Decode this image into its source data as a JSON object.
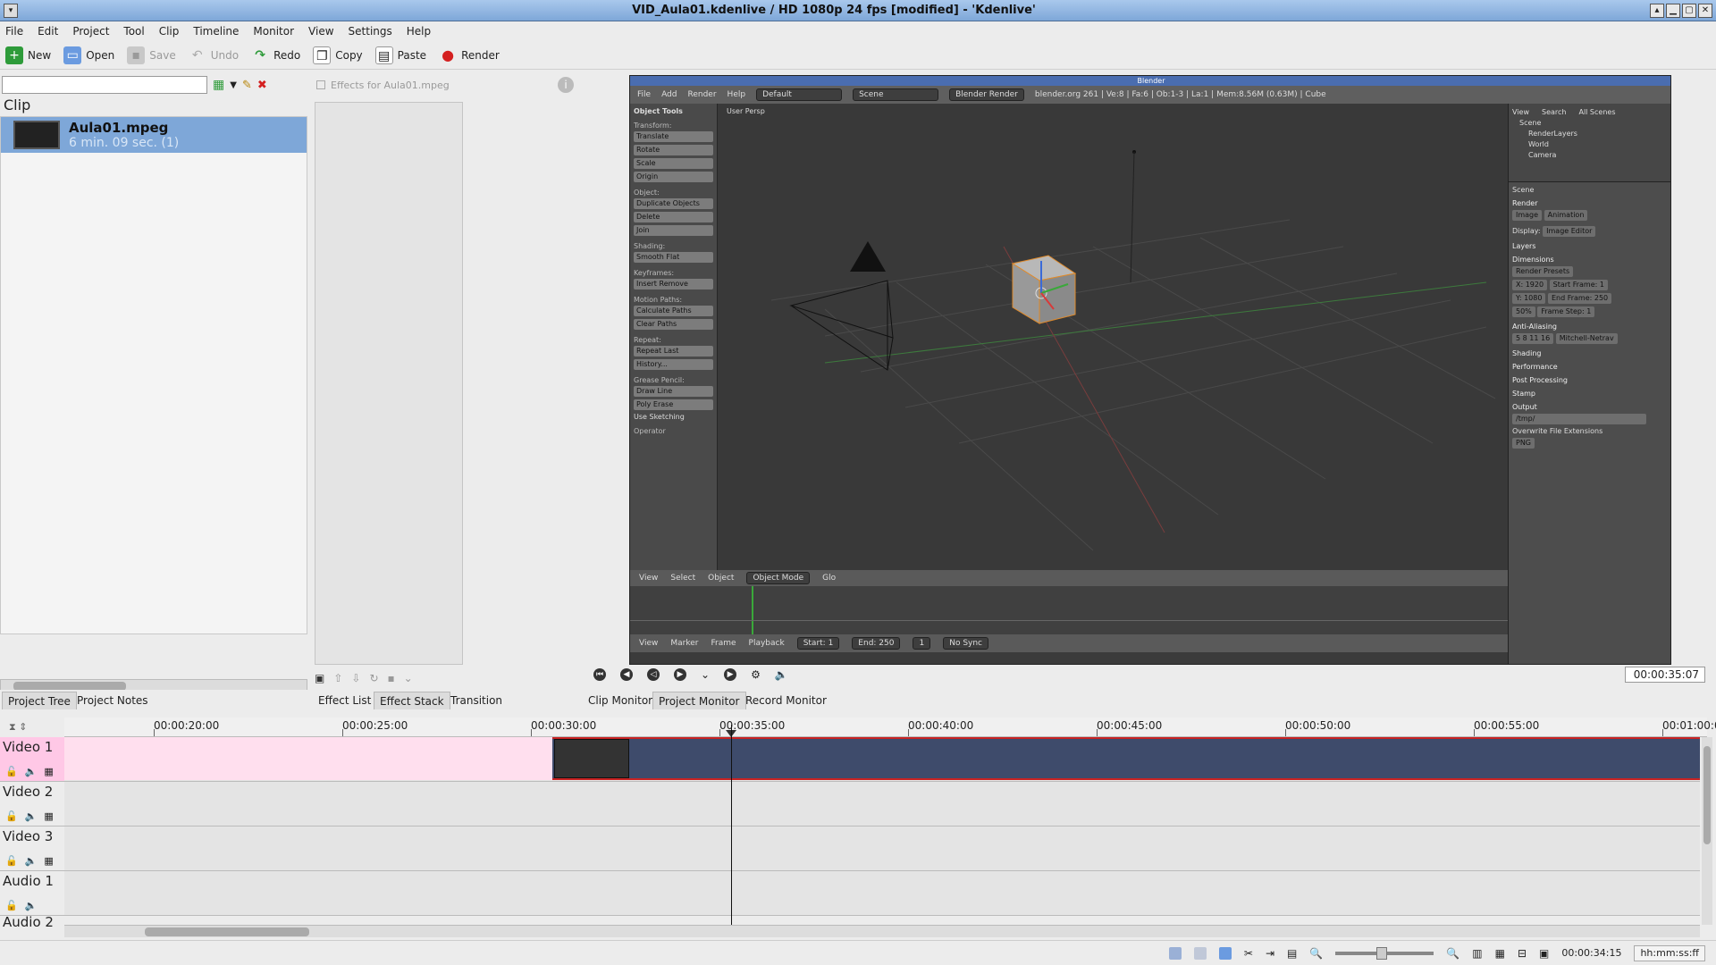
{
  "window": {
    "title": "VID_Aula01.kdenlive / HD 1080p 24 fps [modified] - 'Kdenlive'"
  },
  "menubar": [
    "File",
    "Edit",
    "Project",
    "Tool",
    "Clip",
    "Timeline",
    "Monitor",
    "View",
    "Settings",
    "Help"
  ],
  "toolbar": {
    "new": "New",
    "open": "Open",
    "save": "Save",
    "undo": "Undo",
    "redo": "Redo",
    "copy": "Copy",
    "paste": "Paste",
    "render": "Render"
  },
  "project": {
    "header": "Clip",
    "clip_name": "Aula01.mpeg",
    "clip_duration": "6 min. 09 sec. (1)"
  },
  "effects": {
    "header": "Effects for Aula01.mpeg"
  },
  "blender": {
    "title": "Blender",
    "menu": [
      "File",
      "Add",
      "Render",
      "Help"
    ],
    "layout": "Default",
    "scene": "Scene",
    "engine": "Blender Render",
    "stats": "blender.org 261 | Ve:8 | Fa:6 | Ob:1-3 | La:1 | Mem:8.56M (0.63M) | Cube",
    "viewport_label": "User Persp",
    "object_tools": {
      "header": "Object Tools",
      "transform": "Transform:",
      "translate": "Translate",
      "rotate": "Rotate",
      "scale": "Scale",
      "origin": "Origin",
      "object": "Object:",
      "duplicate": "Duplicate Objects",
      "delete": "Delete",
      "join": "Join",
      "shading": "Shading:",
      "smooth_flat": "Smooth   Flat",
      "keyframes": "Keyframes:",
      "insert_remove": "Insert     Remove",
      "motion_paths": "Motion Paths:",
      "calc_paths": "Calculate Paths",
      "clear_paths": "Clear Paths",
      "repeat": "Repeat:",
      "repeat_last": "Repeat Last",
      "history": "History...",
      "grease": "Grease Pencil:",
      "draw_line": "Draw     Line",
      "poly_erase": "Poly     Erase",
      "use_sketching": "Use Sketching",
      "operator": "Operator"
    },
    "vp_footer": [
      "View",
      "Select",
      "Object",
      "Object Mode",
      "Glo"
    ],
    "tl_footer": [
      "View",
      "Marker",
      "Frame",
      "Playback",
      "Start: 1",
      "End: 250",
      "1",
      "No Sync"
    ],
    "outliner": [
      "Scene",
      "RenderLayers",
      "World",
      "Camera"
    ],
    "outliner_header": [
      "View",
      "Search",
      "All Scenes"
    ],
    "props": {
      "scene": "Scene",
      "render": "Render",
      "image": "Image",
      "animation": "Animation",
      "display": "Display:",
      "image_editor": "Image Editor",
      "layers": "Layers",
      "dimensions": "Dimensions",
      "presets": "Render Presets",
      "res_x": "X: 1920",
      "res_y": "Y: 1080",
      "pct": "50%",
      "start": "Start Frame: 1",
      "end": "End Frame: 250",
      "step": "Frame Step: 1",
      "aa": "Anti-Aliasing",
      "aa_vals": "5  8  11  16",
      "filter": "Mitchell-Netrav",
      "shading": "Shading",
      "performance": "Performance",
      "post": "Post Processing",
      "stamp": "Stamp",
      "output": "Output",
      "path": "/tmp/",
      "overwrite": "Overwrite",
      "ext": "File Extensions",
      "png": "PNG"
    }
  },
  "monitor": {
    "timecode": "00:00:35:07"
  },
  "tabs": {
    "project_tree": "Project Tree",
    "project_notes": "Project Notes",
    "effect_list": "Effect List",
    "effect_stack": "Effect Stack",
    "transition": "Transition",
    "clip_monitor": "Clip Monitor",
    "project_monitor": "Project Monitor",
    "record_monitor": "Record Monitor"
  },
  "ruler": [
    "00:00:20:00",
    "00:00:25:00",
    "00:00:30:00",
    "00:00:35:00",
    "00:00:40:00",
    "00:00:45:00",
    "00:00:50:00",
    "00:00:55:00",
    "00:01:00:00"
  ],
  "tracks": [
    "Video 1",
    "Video 2",
    "Video 3",
    "Audio 1",
    "Audio 2"
  ],
  "status": {
    "time": "00:00:34:15",
    "format": "hh:mm:ss:ff"
  },
  "colors": {
    "selection": "#7ea7d8",
    "clip": "#3e4b6b",
    "clip_border": "#c82323",
    "video1_bg": "#ffdfee"
  }
}
